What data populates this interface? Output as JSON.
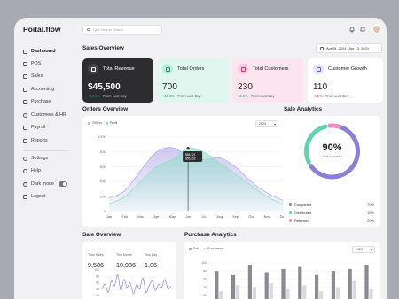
{
  "app": {
    "brand": "Poital.flow"
  },
  "sidebar": {
    "items": [
      {
        "label": "Dashboard",
        "icon": "grid-icon"
      },
      {
        "label": "POS",
        "icon": "register-icon"
      },
      {
        "label": "Sales",
        "icon": "bag-icon"
      },
      {
        "label": "Accounting",
        "icon": "calculator-icon"
      },
      {
        "label": "Purchase",
        "icon": "cart-icon"
      },
      {
        "label": "Customers & HR",
        "icon": "users-icon"
      },
      {
        "label": "Payroll",
        "icon": "wallet-icon"
      },
      {
        "label": "Reports",
        "icon": "document-icon"
      }
    ],
    "bottom": [
      {
        "label": "Settings",
        "icon": "gear-icon"
      },
      {
        "label": "Help",
        "icon": "help-icon"
      },
      {
        "label": "Dark mode",
        "icon": "moon-icon"
      },
      {
        "label": "Logout",
        "icon": "logout-icon"
      }
    ]
  },
  "header": {
    "search_placeholder": "Type Here to Search"
  },
  "sales_overview": {
    "title": "Sales Overview",
    "date_range": "Apr 04, 2024 - Apr 13, 2024",
    "cards": [
      {
        "label": "Total Revenue",
        "value": "$45,500",
        "change": "+10.5%",
        "change_label": "From Last Day",
        "direction": "up",
        "bg": "#2d2d30",
        "icon": "money-icon"
      },
      {
        "label": "Total Orders",
        "value": "700",
        "change": "+15.5%",
        "change_label": "From Last Day",
        "direction": "up",
        "bg": "#dff7ef",
        "icon": "box-icon"
      },
      {
        "label": "Total Customers",
        "value": "230",
        "change": "12.5%",
        "change_label": "From Last Day",
        "direction": "up",
        "bg": "#fde5f0",
        "icon": "users-icon"
      },
      {
        "label": "Customer Growth",
        "value": "110",
        "change": "-6.5%",
        "change_label": "From Last Day",
        "direction": "down",
        "bg": "#ffffff",
        "icon": "growth-icon"
      }
    ]
  },
  "orders_overview": {
    "title": "Orders Overview",
    "year": "2024",
    "tooltip": [
      "$88,121",
      "$55,252"
    ]
  },
  "sale_analytics": {
    "title": "Sale Analytics",
    "center_value": "90%",
    "center_label": "Total completed",
    "rows": [
      {
        "label": "Completed",
        "value": "70%",
        "color": "#8b7fd6"
      },
      {
        "label": "Distributed",
        "value": "15%",
        "color": "#5fd3b0"
      },
      {
        "label": "Returned",
        "value": "20%",
        "color": "#f28cc0"
      }
    ]
  },
  "sale_overview": {
    "title": "Sale Overview",
    "stats": [
      {
        "label": "Total Sales",
        "value": "9,586"
      },
      {
        "label": "This Month",
        "value": "10,986"
      },
      {
        "label": "This Day",
        "value": "1,06"
      }
    ]
  },
  "purchase_analytics": {
    "title": "Purchase Analytics",
    "year": "2024"
  },
  "chart_data": [
    {
      "type": "area",
      "categories": [
        "Jan",
        "Feb",
        "Mar",
        "Apr",
        "May",
        "Jun",
        "Jul",
        "Aug",
        "Sep",
        "Oct",
        "Nov",
        "Dec"
      ],
      "ylim": [
        0,
        100000
      ],
      "yticks": [
        "0",
        "20K",
        "40K",
        "60K",
        "80K",
        "100K"
      ],
      "series": [
        {
          "name": "Orders",
          "color": "#b9ade9",
          "values": [
            18000,
            28000,
            55000,
            80000,
            86000,
            75000,
            70000,
            72000,
            60000,
            40000,
            25000,
            15000
          ]
        },
        {
          "name": "Profit",
          "color": "#8fe0c9",
          "values": [
            10000,
            20000,
            40000,
            60000,
            70000,
            85000,
            80000,
            65000,
            50000,
            35000,
            20000,
            10000
          ]
        }
      ]
    },
    {
      "type": "line",
      "ylim": [
        0,
        100
      ],
      "yticks": [
        "0",
        "20",
        "40",
        "60",
        "80",
        "100"
      ],
      "series": [
        {
          "name": "",
          "color": "#9b8fe3",
          "values": [
            40,
            55,
            30,
            65,
            50,
            85,
            35,
            70,
            45,
            60,
            25,
            55,
            40,
            75,
            30,
            50,
            65,
            35,
            55,
            45,
            70,
            40,
            50
          ]
        }
      ]
    },
    {
      "type": "bar",
      "ylim": [
        0,
        100
      ],
      "yticks": [
        "0",
        "20",
        "40",
        "60",
        "80",
        "100"
      ],
      "series": [
        {
          "name": "Sale",
          "color": "#8a8a90",
          "values": [
            80,
            70,
            95,
            75,
            85,
            90,
            70,
            80,
            85,
            95
          ]
        },
        {
          "name": "Purchases",
          "color": "#d9d9de",
          "values": [
            30,
            45,
            40,
            50,
            35,
            45,
            30,
            40,
            55,
            35
          ]
        }
      ]
    }
  ]
}
